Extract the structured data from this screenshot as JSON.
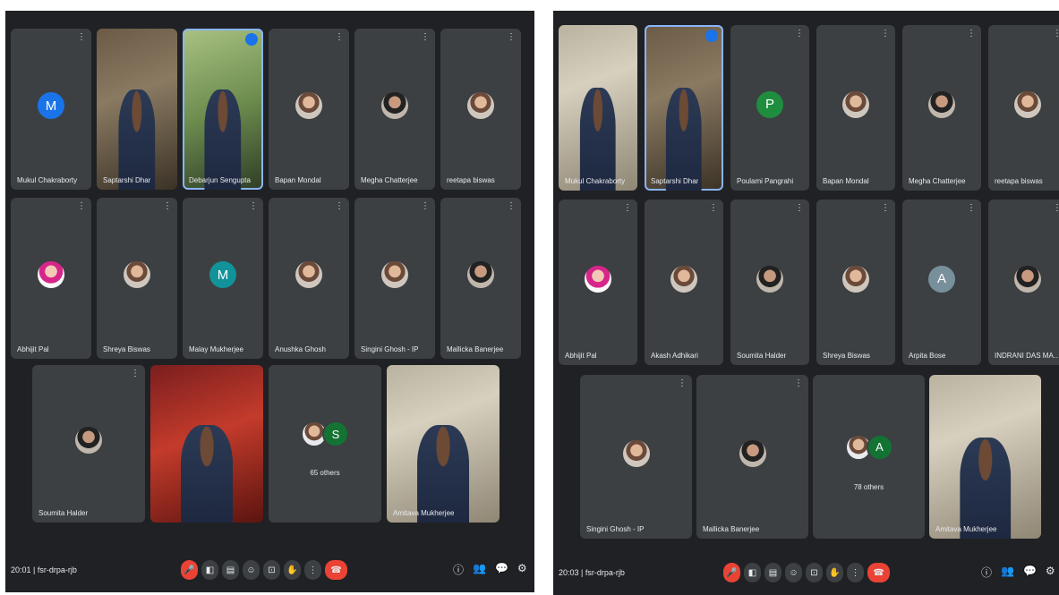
{
  "left": {
    "row1": [
      {
        "name": "Mukul Chakraborty",
        "type": "letter",
        "letter": "M",
        "color": "#1a73e8"
      },
      {
        "name": "Saptarshi Dhar",
        "type": "video",
        "variant": ""
      },
      {
        "name": "Debarjun Sengupta",
        "type": "video",
        "variant": "d",
        "active": true
      },
      {
        "name": "Bapan Mondal",
        "type": "photo"
      },
      {
        "name": "Megha Chatterjee",
        "type": "photo",
        "shade": "dark"
      },
      {
        "name": "reetapa biswas",
        "type": "photo"
      }
    ],
    "row2": [
      {
        "name": "Abhijit Pal",
        "type": "photo",
        "shade": "pink"
      },
      {
        "name": "Shreya Biswas",
        "type": "photo"
      },
      {
        "name": "Malay Mukherjee",
        "type": "letter",
        "letter": "M",
        "color": "#12939a"
      },
      {
        "name": "Anushka Ghosh",
        "type": "photo"
      },
      {
        "name": "Singini Ghosh - IP",
        "type": "photo"
      },
      {
        "name": "Mallicka Banerjee",
        "type": "photo",
        "shade": "dark"
      }
    ],
    "row3": [
      {
        "name": "Soumita Halder",
        "type": "photo",
        "shade": "dark"
      },
      {
        "name": "",
        "type": "video",
        "variant": "c"
      },
      {
        "name": "",
        "type": "others",
        "letter": "S",
        "color": "#137333",
        "label": "65 others"
      },
      {
        "name": "Amitava Mukherjee",
        "type": "video",
        "variant": "b"
      }
    ],
    "clock": "20:01",
    "meeting_code": "fsr-drpa-rjb"
  },
  "right": {
    "row1": [
      {
        "name": "Mukul Chakraborty",
        "type": "video",
        "variant": "b"
      },
      {
        "name": "Saptarshi Dhar",
        "type": "video",
        "variant": "",
        "active": true
      },
      {
        "name": "Poulami Pangrahi",
        "type": "letter",
        "letter": "P",
        "color": "#1e8e3e"
      },
      {
        "name": "Bapan Mondal",
        "type": "photo"
      },
      {
        "name": "Megha Chatterjee",
        "type": "photo",
        "shade": "dark"
      },
      {
        "name": "reetapa biswas",
        "type": "photo"
      }
    ],
    "row2": [
      {
        "name": "Abhijit Pal",
        "type": "photo",
        "shade": "pink"
      },
      {
        "name": "Akash Adhikari",
        "type": "photo"
      },
      {
        "name": "Soumita Halder",
        "type": "photo",
        "shade": "dark"
      },
      {
        "name": "Shreya Biswas",
        "type": "photo"
      },
      {
        "name": "Arpita Bose",
        "type": "letter",
        "letter": "A",
        "color": "#78909c"
      },
      {
        "name": "INDRANI DAS MAHAPAL...",
        "type": "photo",
        "shade": "dark"
      }
    ],
    "row3": [
      {
        "name": "Singini Ghosh - IP",
        "type": "photo"
      },
      {
        "name": "Mallicka Banerjee",
        "type": "photo",
        "shade": "dark"
      },
      {
        "name": "",
        "type": "others",
        "letter": "A",
        "color": "#137333",
        "label": "78 others"
      },
      {
        "name": "Amitava Mukherjee",
        "type": "video",
        "variant": "b"
      }
    ],
    "clock": "20:03",
    "meeting_code": "fsr-drpa-rjb"
  },
  "controls": {
    "icons": [
      "mic-off-icon",
      "cc-icon",
      "present-icon",
      "emoji-icon",
      "screen-icon",
      "raise-hand-icon",
      "more-icon"
    ],
    "glyphs": [
      "🎤",
      "◧",
      "▤",
      "☺",
      "⊡",
      "✋",
      "⋮"
    ],
    "end_glyph": "☎",
    "right_icons": [
      "info-icon",
      "people-icon",
      "chat-icon",
      "activities-icon"
    ],
    "right_glyphs": [
      "ⓘ",
      "👥",
      "💬",
      "⚙"
    ]
  }
}
